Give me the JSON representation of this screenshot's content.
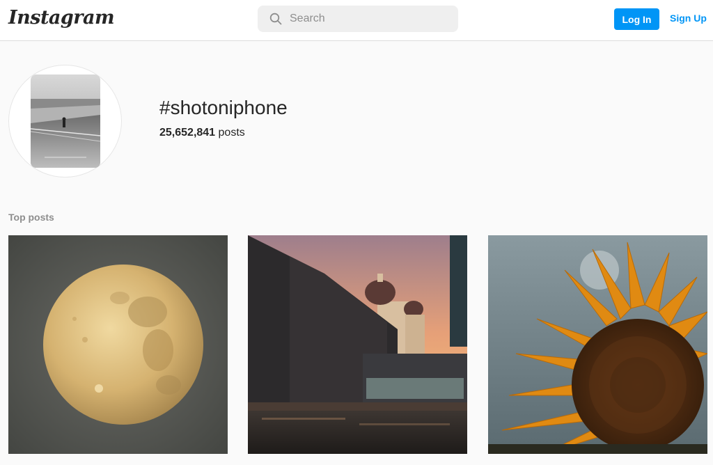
{
  "header": {
    "logo_text": "Instagram",
    "search": {
      "placeholder": "Search",
      "icon": "search-icon"
    },
    "login_label": "Log In",
    "signup_label": "Sign Up",
    "accent_color": "#0095f6"
  },
  "profile": {
    "hashtag": "#shotoniphone",
    "post_count": "25,652,841",
    "post_count_suffix": "posts"
  },
  "section": {
    "top_posts_label": "Top posts"
  },
  "posts": [
    {
      "subject": "moon"
    },
    {
      "subject": "city-building-dusk"
    },
    {
      "subject": "sunflower"
    }
  ]
}
